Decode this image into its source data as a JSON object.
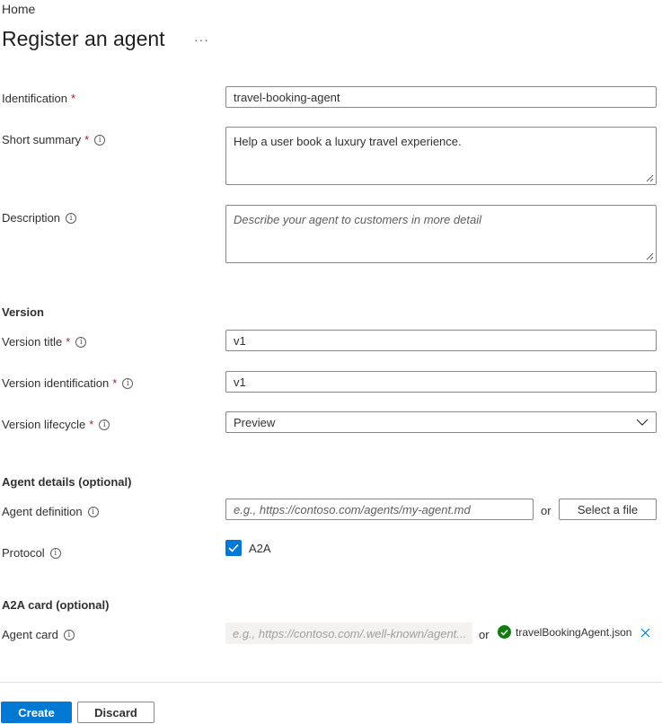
{
  "breadcrumb": "Home",
  "title": "Register an agent",
  "more_icon": "ellipsis-icon",
  "required_mark": "*",
  "fields": {
    "identification": {
      "label": "Identification",
      "value": "travel-booking-agent"
    },
    "short_summary": {
      "label": "Short summary",
      "value": "Help a user book a luxury travel experience."
    },
    "description": {
      "label": "Description",
      "placeholder": "Describe your agent to customers in more detail"
    }
  },
  "version": {
    "heading": "Version",
    "title": {
      "label": "Version title",
      "value": "v1"
    },
    "identification": {
      "label": "Version identification",
      "value": "v1"
    },
    "lifecycle": {
      "label": "Version lifecycle",
      "value": "Preview"
    }
  },
  "agent_details": {
    "heading": "Agent details (optional)",
    "definition": {
      "label": "Agent definition",
      "placeholder": "e.g., https://contoso.com/agents/my-agent.md"
    },
    "or": "or",
    "select_file": "Select a file",
    "protocol": {
      "label": "Protocol",
      "option": "A2A",
      "checked": true
    }
  },
  "a2a_card": {
    "heading": "A2A card (optional)",
    "label": "Agent card",
    "placeholder": "e.g., https://contoso.com/.well-known/agent...",
    "or": "or",
    "file_name": "travelBookingAgent.json"
  },
  "actions": {
    "create": "Create",
    "discard": "Discard"
  },
  "colors": {
    "accent": "#0078d4",
    "required": "#a4262c",
    "success": "#107c10"
  }
}
